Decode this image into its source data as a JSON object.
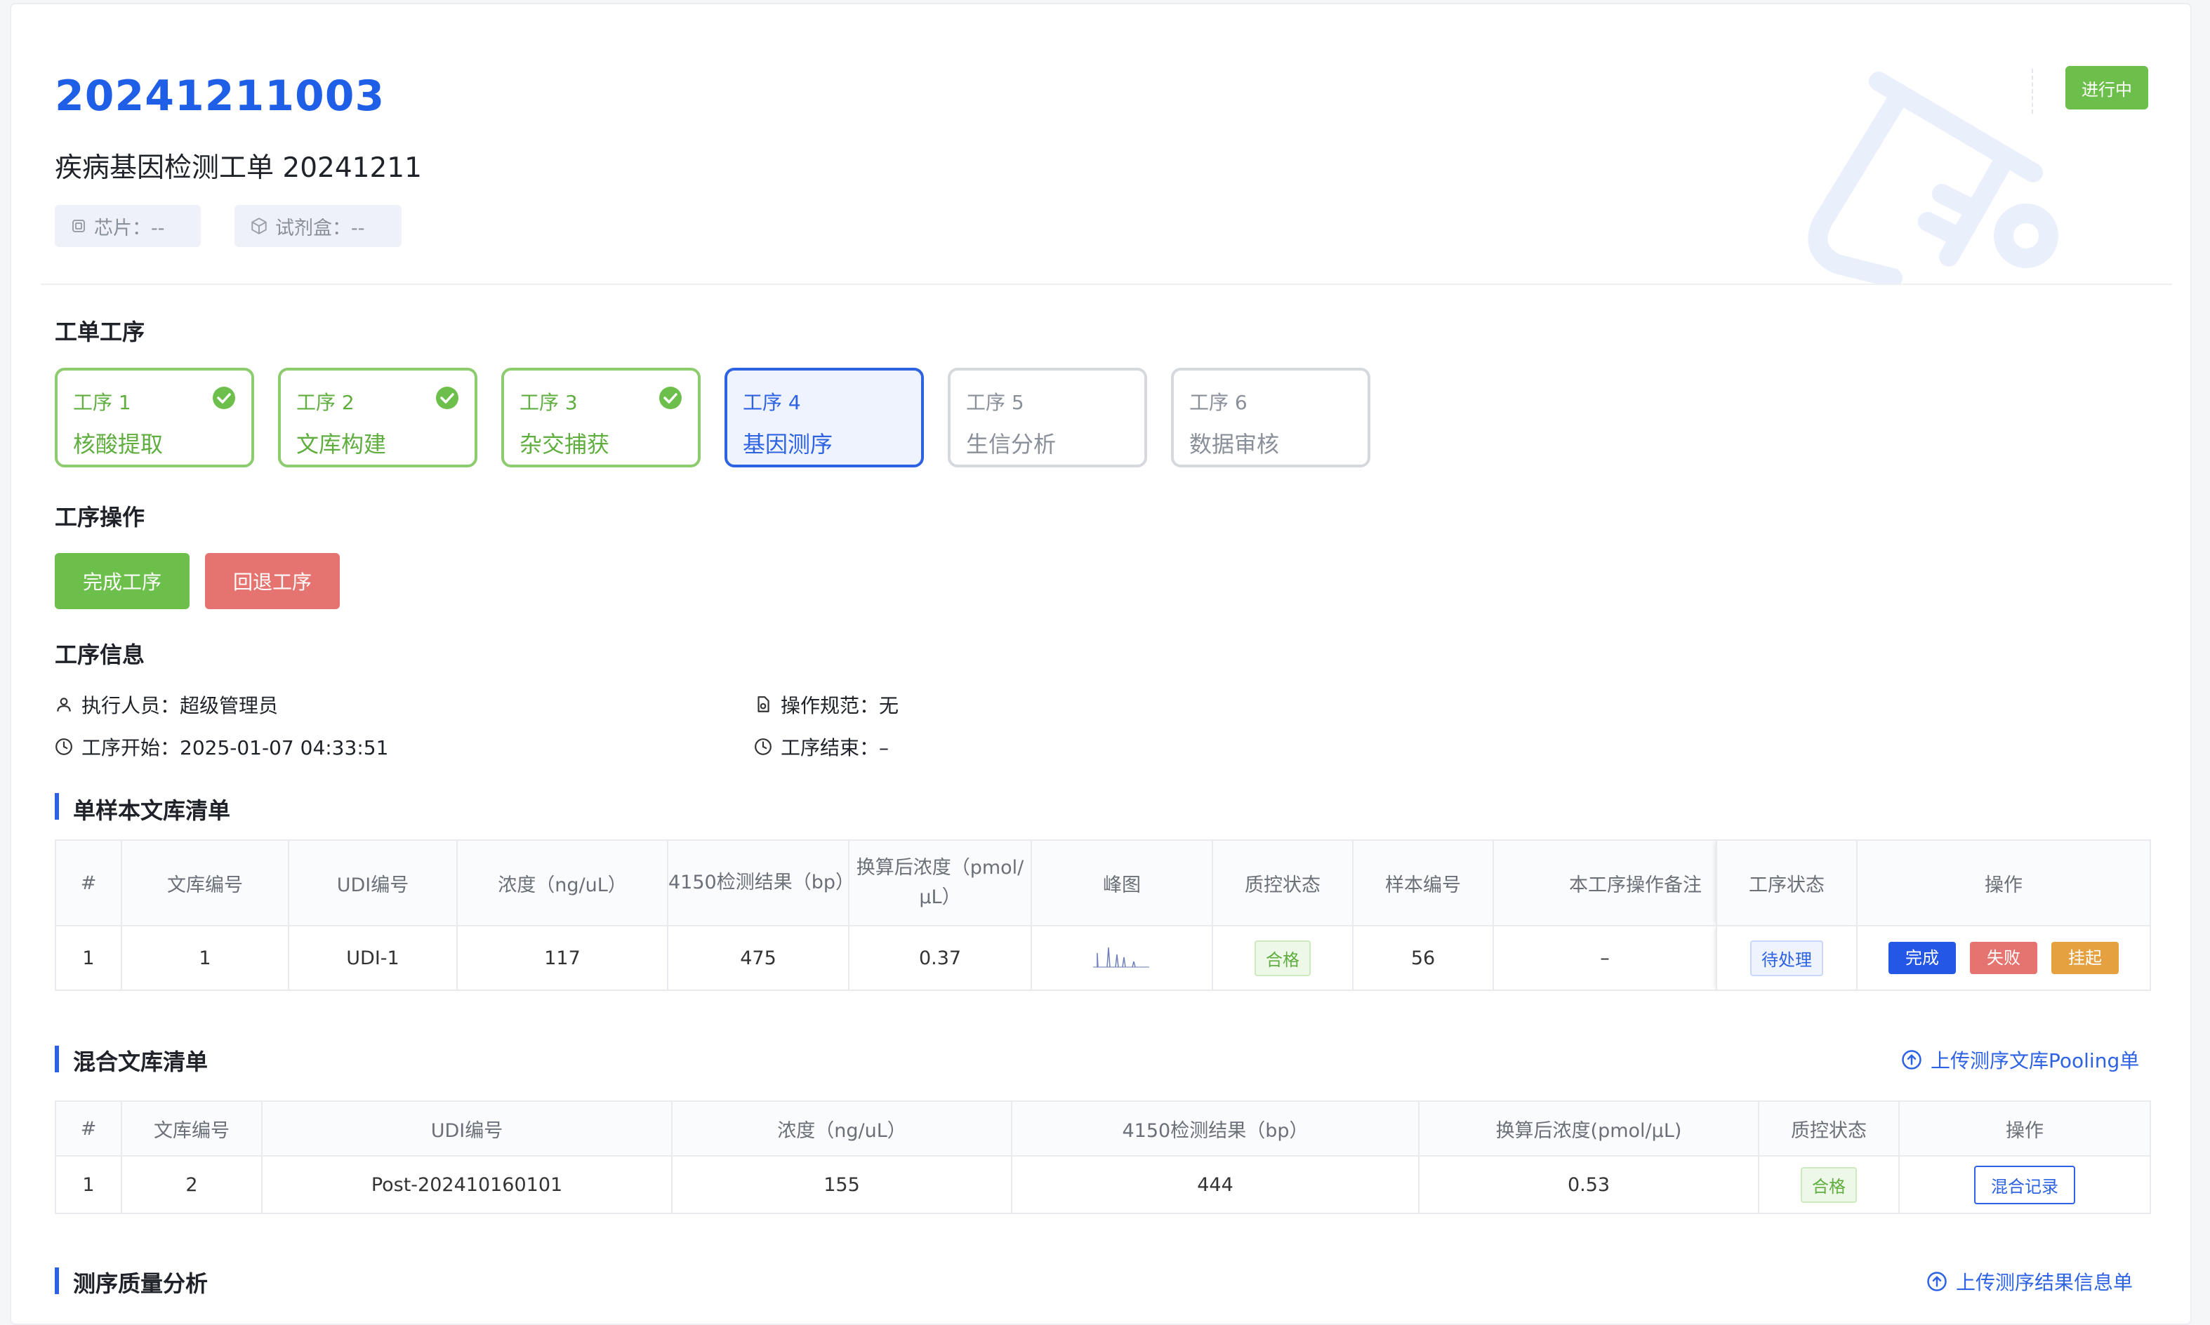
{
  "header": {
    "order_id": "20241211003",
    "order_name": "疾病基因检测工单 20241211",
    "chip_label": "芯片：--",
    "kit_label": "试剂盒：--",
    "status": "进行中",
    "colors": {
      "accent": "#2d62e3",
      "success": "#6cbf4b",
      "danger": "#e5736f",
      "warning": "#e5a13f"
    }
  },
  "steps_section": {
    "title": "工单工序",
    "steps": [
      {
        "no": "工序 1",
        "name": "核酸提取",
        "state": "done"
      },
      {
        "no": "工序 2",
        "name": "文库构建",
        "state": "done"
      },
      {
        "no": "工序 3",
        "name": "杂交捕获",
        "state": "done"
      },
      {
        "no": "工序 4",
        "name": "基因测序",
        "state": "active"
      },
      {
        "no": "工序 5",
        "name": "生信分析",
        "state": "todo"
      },
      {
        "no": "工序 6",
        "name": "数据审核",
        "state": "todo"
      }
    ]
  },
  "ops_section": {
    "title": "工序操作",
    "complete_label": "完成工序",
    "rollback_label": "回退工序"
  },
  "info_section": {
    "title": "工序信息",
    "executor": "执行人员：超级管理员",
    "spec": "操作规范：无",
    "start": "工序开始：2025-01-07 04:33:51",
    "end": "工序结束：–"
  },
  "single_library": {
    "title": "单样本文库清单",
    "columns": [
      "#",
      "文库编号",
      "UDI编号",
      "浓度（ng/uL）",
      "4150检测结果（bp）",
      "换算后浓度（pmol/μL）",
      "峰图",
      "质控状态",
      "样本编号",
      "本工序操作备注",
      "工序状态",
      "操作"
    ],
    "rows": [
      {
        "idx": "1",
        "lib_no": "1",
        "udi": "UDI-1",
        "conc": "117",
        "result": "475",
        "conv": "0.37",
        "qc": "合格",
        "sample": "56",
        "remark": "–",
        "status": "待处理"
      }
    ],
    "actions": {
      "complete": "完成",
      "fail": "失败",
      "hold": "挂起"
    }
  },
  "mixed_library": {
    "title": "混合文库清单",
    "upload_label": "上传测序文库Pooling单",
    "columns": [
      "#",
      "文库编号",
      "UDI编号",
      "浓度（ng/uL）",
      "4150检测结果（bp）",
      "换算后浓度(pmol/μL)",
      "质控状态",
      "操作"
    ],
    "rows": [
      {
        "idx": "1",
        "lib_no": "2",
        "udi": "Post-202410160101",
        "conc": "155",
        "result": "444",
        "conv": "0.53",
        "qc": "合格",
        "action": "混合记录"
      }
    ]
  },
  "quality": {
    "title": "测序质量分析",
    "upload_label": "上传测序结果信息单"
  }
}
